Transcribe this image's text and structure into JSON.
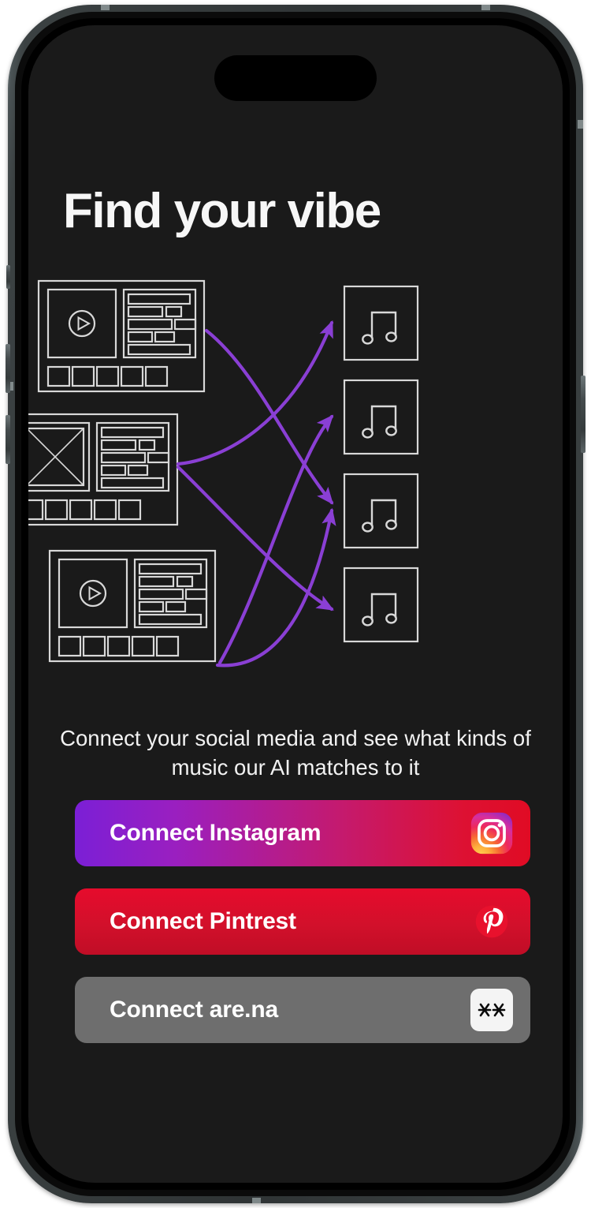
{
  "device": {
    "type": "smartphone-mockup",
    "notch": "dynamic-island",
    "frame_color": "#3b4142",
    "screen_bg": "#1a1a1a"
  },
  "screen": {
    "title": "Find your vibe",
    "description": "Connect your social media and see what kinds of music our AI matches to it"
  },
  "diagram": {
    "label": "social-to-music-matching-diagram",
    "arrow_color": "#8a3fd4",
    "stroke_color": "#d8d8d8",
    "source_cards": [
      {
        "id": "card-1",
        "media_icon": "play-icon",
        "thumbnails": 5,
        "text_rows": 5
      },
      {
        "id": "card-2",
        "media_icon": "image-placeholder-icon",
        "thumbnails": 5,
        "text_rows": 5
      },
      {
        "id": "card-3",
        "media_icon": "play-icon",
        "thumbnails": 5,
        "text_rows": 5
      }
    ],
    "target_cards": [
      {
        "id": "music-1",
        "icon": "music-note-icon"
      },
      {
        "id": "music-2",
        "icon": "music-note-icon"
      },
      {
        "id": "music-3",
        "icon": "music-note-icon"
      },
      {
        "id": "music-4",
        "icon": "music-note-icon"
      }
    ],
    "connections": [
      {
        "from": "card-1",
        "to": "music-3"
      },
      {
        "from": "card-2",
        "to": "music-1"
      },
      {
        "from": "card-2",
        "to": "music-4"
      },
      {
        "from": "card-3",
        "to": "music-2"
      },
      {
        "from": "card-3",
        "to": "music-3"
      }
    ]
  },
  "connect_buttons": [
    {
      "id": "instagram",
      "label": "Connect Instagram",
      "icon": "instagram-icon",
      "accent": "#c41a6f"
    },
    {
      "id": "pintrest",
      "label": "Connect Pintrest",
      "icon": "pinterest-icon",
      "accent": "#d2102b"
    },
    {
      "id": "arena",
      "label": "Connect are.na",
      "icon": "arena-icon",
      "accent": "#6e6e6e"
    }
  ]
}
